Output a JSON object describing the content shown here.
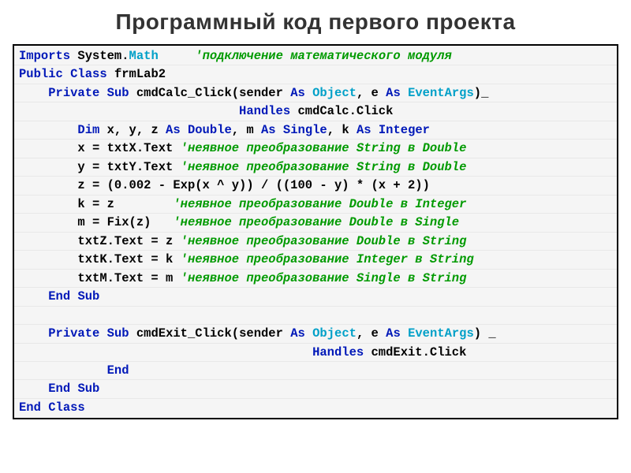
{
  "title": "Программный код первого проекта",
  "code": {
    "l1_kw": "Imports",
    "l1_t1": " System.",
    "l1_typ": "Math",
    "l1_gap": "     ",
    "l1_cmt": "'подключение математического модуля",
    "l2_kw1": "Public",
    "l2_kw2": "Class",
    "l2_t1": " frmLab2",
    "l3_kw1": "Private",
    "l3_kw2": "Sub",
    "l3_t1": " cmdCalc_Click(sender ",
    "l3_kw3": "As",
    "l3_typ1": " Object",
    "l3_t2": ", e ",
    "l3_kw4": "As",
    "l3_typ2": " EventArgs",
    "l3_t3": ")_",
    "l4_kw1": "Handles",
    "l4_t1": " cmdCalc.Click",
    "l5_kw1": "Dim",
    "l5_t1": " x, y, z ",
    "l5_kw2": "As",
    "l5_typ1": " Double",
    "l5_t2": ", m ",
    "l5_kw3": "As",
    "l5_typ2": " Single",
    "l5_t3": ", k ",
    "l5_kw4": "As",
    "l5_typ3": " Integer",
    "l6_t1": "x = txtX.Text ",
    "l6_cmt": "'неявное преобразование String в Double",
    "l7_t1": "y = txtY.Text ",
    "l7_cmt": "'неявное преобразование String в Double",
    "l8_t1": "z = (0.002 - Exp(x ^ y)) / ((100 - y) * (x + 2))",
    "l9_t1": "k = z        ",
    "l9_cmt": "'неявное преобразование Double в Integer",
    "l10_t1": "m = Fix(z)   ",
    "l10_cmt": "'неявное преобразование Double в Single",
    "l11_t1": "txtZ.Text = z ",
    "l11_cmt": "'неявное преобразование Double в String",
    "l12_t1": "txtK.Text = k ",
    "l12_cmt": "'неявное преобразование Integer в String",
    "l13_t1": "txtM.Text = m ",
    "l13_cmt": "'неявное преобразование Single в String",
    "l14_kw1": "End",
    "l14_kw2": "Sub",
    "blank": " ",
    "l16_kw1": "Private",
    "l16_kw2": "Sub",
    "l16_t1": " cmdExit_Click(sender ",
    "l16_kw3": "As",
    "l16_typ1": " Object",
    "l16_t2": ", e ",
    "l16_kw4": "As",
    "l16_typ2": " EventArgs",
    "l16_t3": ") _",
    "l17_kw1": "Handles",
    "l17_t1": " cmdExit.Click",
    "l18_kw1": "End",
    "l19_kw1": "End",
    "l19_kw2": "Sub",
    "l20_kw1": "End",
    "l20_kw2": "Class"
  },
  "indent": {
    "i0": "",
    "i1": "    ",
    "i2": "        ",
    "i3": "            ",
    "i_handles": "                              ",
    "i_handles2": "                                        "
  }
}
